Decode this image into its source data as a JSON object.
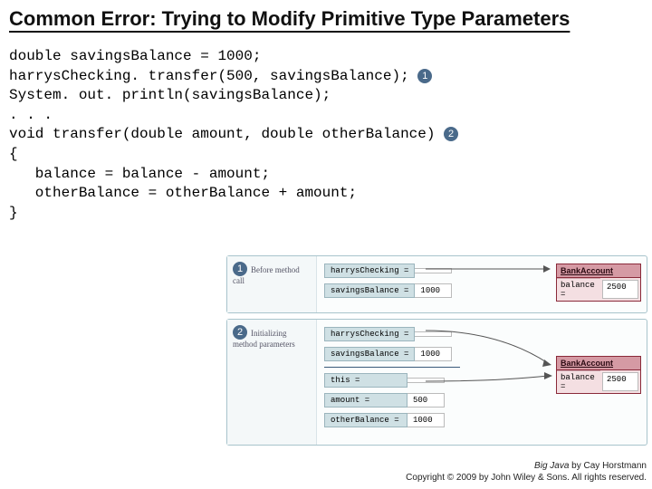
{
  "title": "Common Error: Trying to Modify Primitive Type Parameters",
  "code": {
    "l1": "double savingsBalance = 1000;",
    "l2a": "harrysChecking. transfer(500, savingsBalance); ",
    "l3": "System. out. println(savingsBalance);",
    "l4": ". . .",
    "l5a": "void transfer(double amount, double otherBalance) ",
    "l6": "{",
    "l7": "   balance = balance - amount;",
    "l8": "   otherBalance = otherBalance + amount;",
    "l9": "}"
  },
  "bullets": {
    "b1": "1",
    "b2": "2"
  },
  "diagram": {
    "panel1": {
      "caption": "Before method call",
      "vars": [
        {
          "label": "harrysChecking =",
          "val": ""
        },
        {
          "label": "savingsBalance =",
          "val": "1000"
        }
      ],
      "obj": {
        "title": "BankAccount",
        "field": "balance =",
        "value": "2500"
      }
    },
    "panel2": {
      "caption": "Initializing method parameters",
      "varsTop": [
        {
          "label": "harrysChecking =",
          "val": ""
        },
        {
          "label": "savingsBalance =",
          "val": "1000"
        }
      ],
      "varsBot": [
        {
          "label": "this =",
          "val": ""
        },
        {
          "label": "amount =",
          "val": "500"
        },
        {
          "label": "otherBalance =",
          "val": "1000"
        }
      ],
      "obj": {
        "title": "BankAccount",
        "field": "balance =",
        "value": "2500"
      }
    }
  },
  "footer": {
    "l1_pre": "Big Java",
    "l1_post": " by Cay Horstmann",
    "l2": "Copyright © 2009 by John Wiley & Sons. All rights reserved."
  }
}
